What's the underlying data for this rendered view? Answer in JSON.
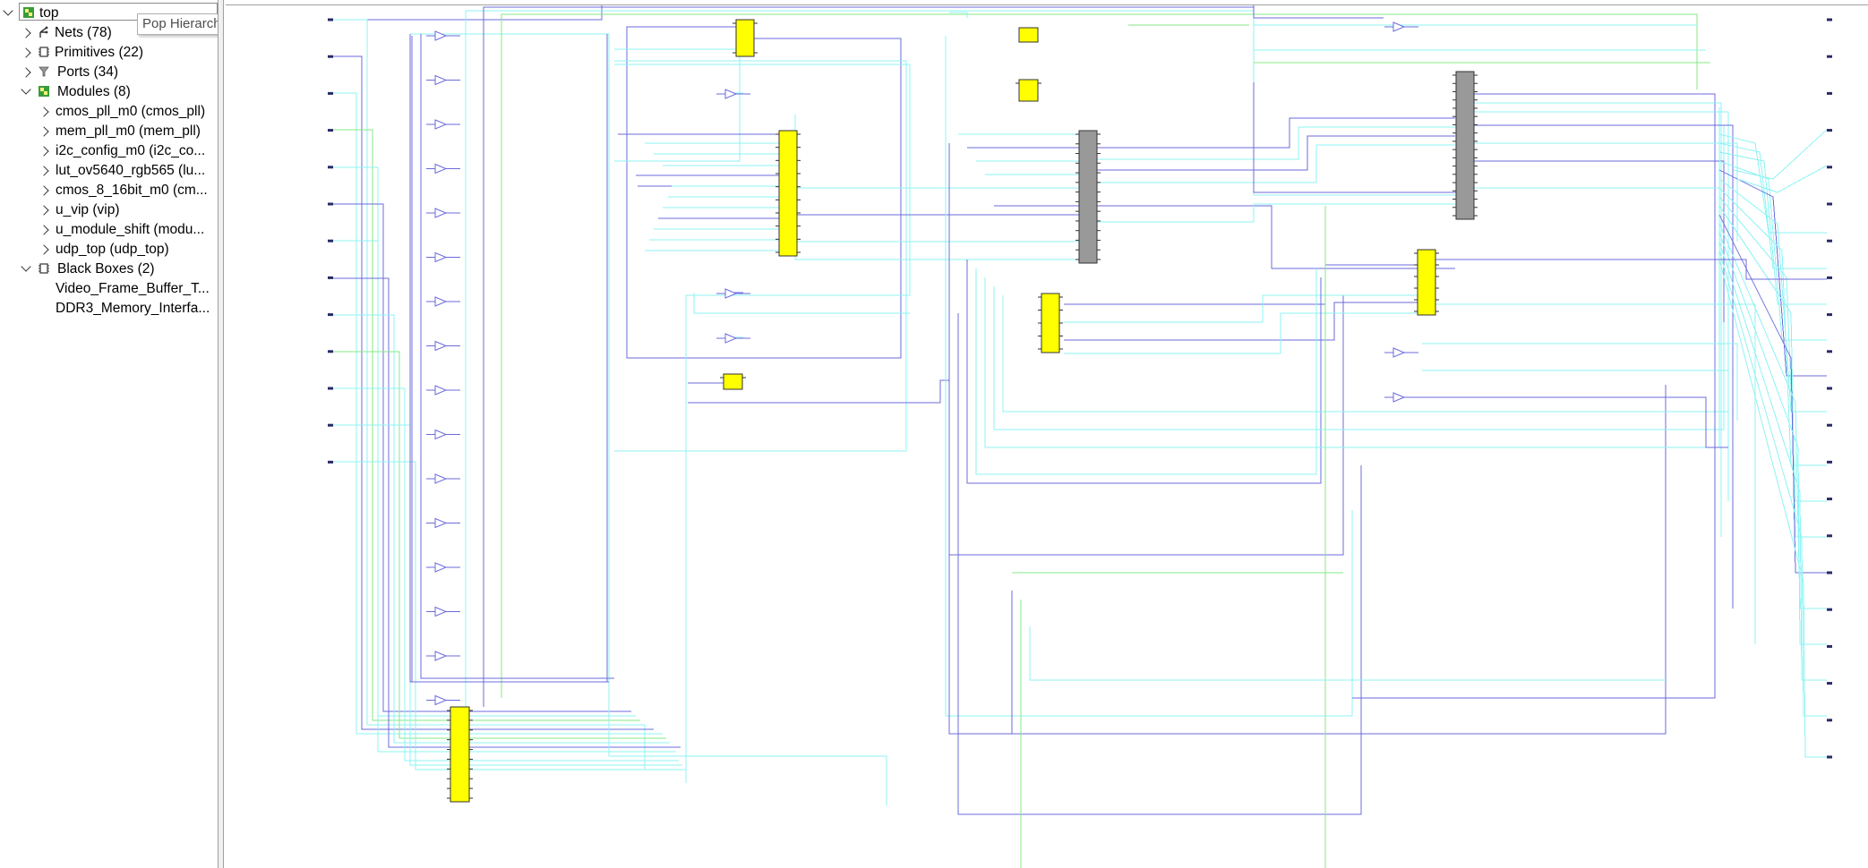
{
  "hierarchy": {
    "root": {
      "label": "top",
      "icon": "module-icon"
    },
    "items": [
      {
        "label": "Nets (78)",
        "icon": "net-icon",
        "expanded": false
      },
      {
        "label": "Primitives (22)",
        "icon": "primitive-icon",
        "expanded": false
      },
      {
        "label": "Ports (34)",
        "icon": "port-icon",
        "expanded": false
      },
      {
        "label": "Modules (8)",
        "icon": "module-icon",
        "expanded": true
      },
      {
        "label": "cmos_pll_m0 (cmos_pll)"
      },
      {
        "label": "mem_pll_m0 (mem_pll)"
      },
      {
        "label": "i2c_config_m0 (i2c_co..."
      },
      {
        "label": "lut_ov5640_rgb565 (lu..."
      },
      {
        "label": "cmos_8_16bit_m0 (cm..."
      },
      {
        "label": "u_vip (vip)"
      },
      {
        "label": "u_module_shift (modu..."
      },
      {
        "label": "udp_top (udp_top)"
      },
      {
        "label": "Black Boxes (2)",
        "icon": "primitive-icon",
        "expanded": true
      },
      {
        "label": "Video_Frame_Buffer_T..."
      },
      {
        "label": "DDR3_Memory_Interfa..."
      }
    ]
  },
  "tooltip": {
    "text": "Pop Hierarchy"
  },
  "colors": {
    "module_fill": "#ffff00",
    "blackbox_fill": "#999999",
    "wire_blue": "#6b6bdd",
    "wire_cyan": "#8ff3f3",
    "wire_green": "#86ea86",
    "port": "#2a2a66",
    "folder_icon": "#3a9c3a"
  },
  "schematic": {
    "left_port_count": 13,
    "right_port_count": 21,
    "buffer_count": 25,
    "module_count": 11,
    "blackbox_count": 2
  }
}
